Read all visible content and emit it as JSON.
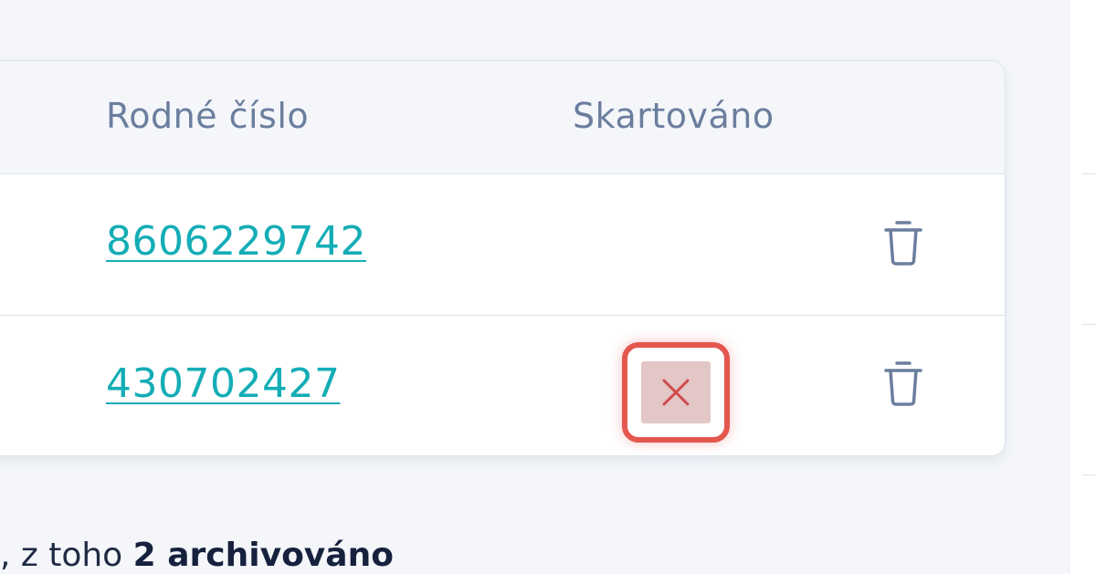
{
  "table": {
    "headers": {
      "birth_number": "Rodné číslo",
      "shredded": "Skartováno"
    },
    "rows": [
      {
        "birth_number": "8606229742",
        "shredded": "",
        "delete_icon": "trash-icon"
      },
      {
        "birth_number": "430702427",
        "shredded": "x-icon",
        "delete_icon": "trash-icon"
      }
    ]
  },
  "summary": {
    "prefix": ", z toho ",
    "archived_count": "2",
    "archived_label": " archivováno"
  },
  "colors": {
    "link": "#14adb6",
    "header_text": "#6b7e9e",
    "highlight": "#e4574e",
    "not_shredded_bg": "#e3c6c6",
    "not_shredded_x": "#d04a4a"
  }
}
